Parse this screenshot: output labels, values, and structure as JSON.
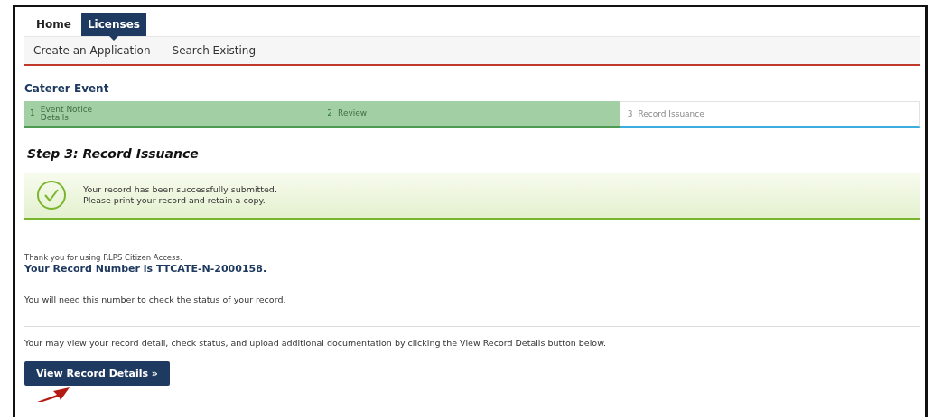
{
  "nav": {
    "tabs": [
      {
        "label": "Home",
        "selected": false
      },
      {
        "label": "Licenses",
        "selected": true
      }
    ],
    "subnav": [
      "Create an Application",
      "Search Existing"
    ]
  },
  "page_title": "Caterer Event",
  "steps": [
    {
      "number": "1",
      "label": "Event Notice Details",
      "completed": true,
      "selected": false
    },
    {
      "number": "2",
      "label": "Review",
      "completed": true,
      "selected": false
    },
    {
      "number": "3",
      "label": "Record Issuance",
      "completed": false,
      "selected": true
    }
  ],
  "step_heading": "Step 3: Record Issuance",
  "success": {
    "lines": [
      "Your record has been successfully submitted.",
      "Please print your record and retain a copy."
    ]
  },
  "thanks": "Thank you for using RLPS Citizen Access.",
  "record_number": "Your Record Number is TTCATE-N-2000158.",
  "need_number": "You will need this number to check the status of your record.",
  "details_note": "Your may view your record detail, check status, and upload additional documentation by clicking the View Record Details button below.",
  "button": "View Record Details »"
}
